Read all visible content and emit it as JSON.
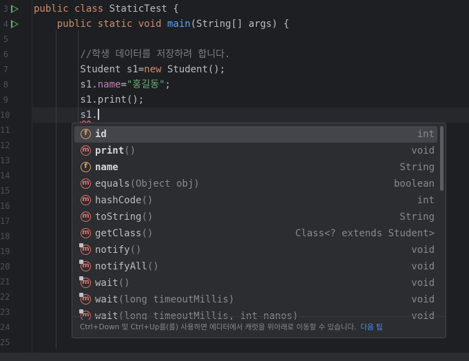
{
  "editor": {
    "lines": [
      {
        "num": "3",
        "run": true,
        "tokens": [
          [
            "kw",
            "public class "
          ],
          [
            "plain",
            "StaticTest {"
          ]
        ]
      },
      {
        "num": "4",
        "run": true,
        "tokens": [
          [
            "plain",
            "    "
          ],
          [
            "kw",
            "public static void "
          ],
          [
            "fn",
            "main"
          ],
          [
            "plain",
            "(String[] args) {"
          ]
        ]
      },
      {
        "num": "5",
        "run": false,
        "tokens": []
      },
      {
        "num": "6",
        "run": false,
        "tokens": [
          [
            "plain",
            "        "
          ],
          [
            "cmt",
            "//학생 데이터를 저장하려 합니다."
          ]
        ]
      },
      {
        "num": "7",
        "run": false,
        "tokens": [
          [
            "plain",
            "        Student s1="
          ],
          [
            "kw",
            "new "
          ],
          [
            "plain",
            "Student();"
          ]
        ]
      },
      {
        "num": "8",
        "run": false,
        "tokens": [
          [
            "plain",
            "        s1."
          ],
          [
            "fld",
            "name"
          ],
          [
            "plain",
            "="
          ],
          [
            "str",
            "\"홍길동\""
          ],
          [
            "plain",
            ";"
          ]
        ]
      },
      {
        "num": "9",
        "run": false,
        "tokens": [
          [
            "plain",
            "        s1.print();"
          ]
        ]
      },
      {
        "num": "10",
        "run": false,
        "tokens": [
          [
            "plain",
            "        "
          ],
          [
            "squiggle",
            "s1"
          ],
          [
            "plain",
            "."
          ],
          [
            "caret",
            ""
          ]
        ]
      },
      {
        "num": "11",
        "run": false,
        "tokens": []
      },
      {
        "num": "12",
        "run": false,
        "tokens": []
      },
      {
        "num": "13",
        "run": false,
        "tokens": []
      },
      {
        "num": "14",
        "run": false,
        "tokens": []
      },
      {
        "num": "15",
        "run": false,
        "tokens": []
      },
      {
        "num": "16",
        "run": false,
        "tokens": []
      },
      {
        "num": "17",
        "run": false,
        "tokens": []
      },
      {
        "num": "18",
        "run": false,
        "tokens": []
      },
      {
        "num": "19",
        "run": false,
        "tokens": []
      },
      {
        "num": "20",
        "run": false,
        "tokens": []
      },
      {
        "num": "21",
        "run": false,
        "tokens": []
      },
      {
        "num": "22",
        "run": false,
        "tokens": []
      },
      {
        "num": "23",
        "run": false,
        "tokens": []
      },
      {
        "num": "24",
        "run": false,
        "tokens": []
      },
      {
        "num": "25",
        "run": false,
        "tokens": []
      }
    ]
  },
  "completion": {
    "items": [
      {
        "kind": "f",
        "icon": "field-icon",
        "name": "id",
        "params": "",
        "type": "int",
        "bold": true,
        "locked": false,
        "selected": true
      },
      {
        "kind": "m",
        "icon": "method-icon",
        "name": "print",
        "params": "()",
        "type": "void",
        "bold": true,
        "locked": false,
        "selected": false
      },
      {
        "kind": "f",
        "icon": "field-icon",
        "name": "name",
        "params": "",
        "type": "String",
        "bold": true,
        "locked": false,
        "selected": false
      },
      {
        "kind": "m",
        "icon": "method-icon",
        "name": "equals",
        "params": "(Object obj)",
        "type": "boolean",
        "bold": false,
        "locked": false,
        "selected": false
      },
      {
        "kind": "m",
        "icon": "method-icon",
        "name": "hashCode",
        "params": "()",
        "type": "int",
        "bold": false,
        "locked": false,
        "selected": false
      },
      {
        "kind": "m",
        "icon": "method-icon",
        "name": "toString",
        "params": "()",
        "type": "String",
        "bold": false,
        "locked": false,
        "selected": false
      },
      {
        "kind": "m",
        "icon": "method-icon",
        "name": "getClass",
        "params": "()",
        "type": "Class<? extends Student>",
        "bold": false,
        "locked": false,
        "selected": false
      },
      {
        "kind": "m",
        "icon": "method-icon",
        "name": "notify",
        "params": "()",
        "type": "void",
        "bold": false,
        "locked": true,
        "selected": false
      },
      {
        "kind": "m",
        "icon": "method-icon",
        "name": "notifyAll",
        "params": "()",
        "type": "void",
        "bold": false,
        "locked": true,
        "selected": false
      },
      {
        "kind": "m",
        "icon": "method-icon",
        "name": "wait",
        "params": "()",
        "type": "void",
        "bold": false,
        "locked": true,
        "selected": false
      },
      {
        "kind": "m",
        "icon": "method-icon",
        "name": "wait",
        "params": "(long timeoutMillis)",
        "type": "void",
        "bold": false,
        "locked": true,
        "selected": false
      },
      {
        "kind": "m",
        "icon": "method-icon",
        "name": "wait",
        "params": "(long timeoutMillis, int nanos)",
        "type": "void",
        "bold": false,
        "locked": true,
        "selected": false
      }
    ],
    "hint": "Ctrl+Down 및 Ctrl+Up를(를) 사용하면 에디터에서 캐럿을 위아래로 이동할 수 있습니다.",
    "hint_link": "다음 팁"
  }
}
